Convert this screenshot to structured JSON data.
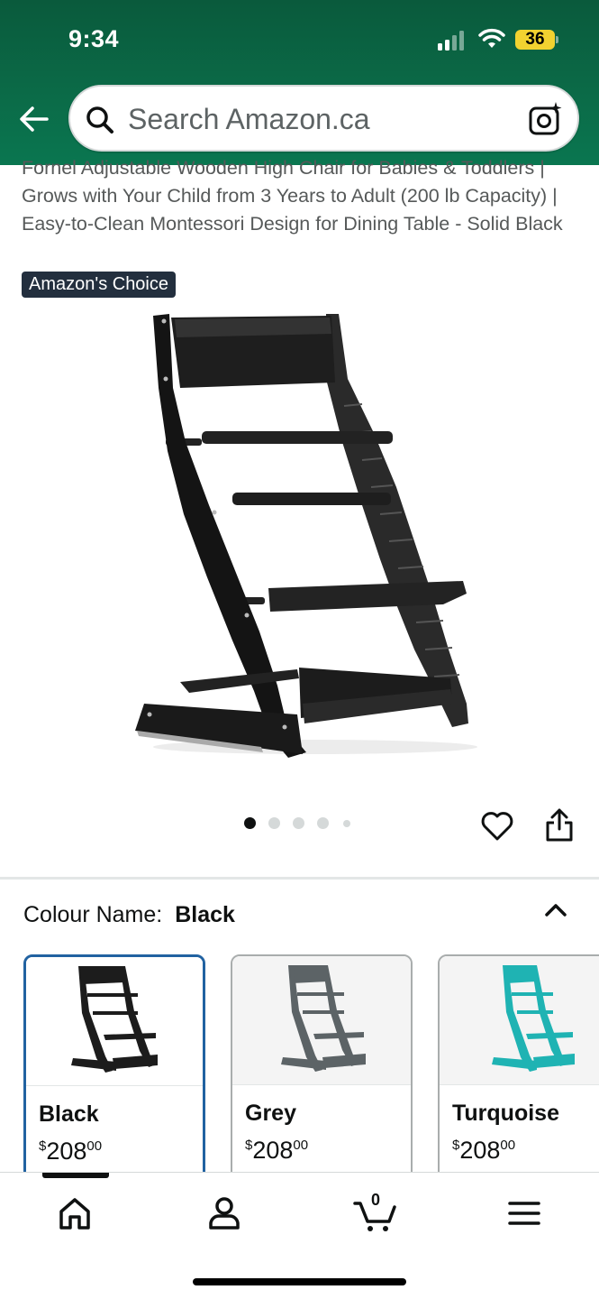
{
  "status_bar": {
    "time": "9:34",
    "battery": "36"
  },
  "header": {
    "search_placeholder": "Search Amazon.ca",
    "back_icon": "back-arrow-icon",
    "search_icon": "search-icon",
    "camera_icon": "camera-search-icon"
  },
  "product": {
    "title": "Fornel Adjustable Wooden High Chair for Babies & Toddlers | Grows with Your Child from 3 Years to Adult (200 lb Capacity) | Easy-to-Clean Montessori Design for Dining Table - Solid Black",
    "badge": "Amazon's Choice",
    "image_count": 5,
    "current_image": 1
  },
  "colour": {
    "label": "Colour Name:",
    "selected": "Black",
    "options": [
      {
        "name": "Black",
        "currency": "$",
        "price_whole": "208",
        "price_fraction": "00",
        "color": "#1c1c1c"
      },
      {
        "name": "Grey",
        "currency": "$",
        "price_whole": "208",
        "price_fraction": "00",
        "color": "#5c6366"
      },
      {
        "name": "Turquoise",
        "currency": "$",
        "price_whole": "208",
        "price_fraction": "00",
        "color": "#1fb3b3"
      }
    ]
  },
  "bottom_nav": {
    "items": [
      "home-icon",
      "account-icon",
      "cart-icon",
      "menu-icon"
    ],
    "cart_count": "0"
  },
  "theme": {
    "header_green": "#0a6a47",
    "selected_border": "#2162a1",
    "badge_bg": "#232f3e"
  }
}
